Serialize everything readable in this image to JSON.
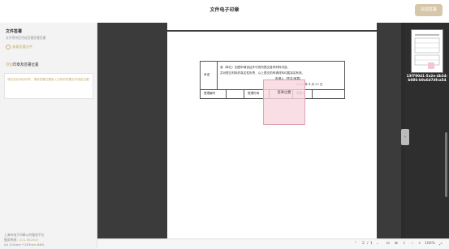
{
  "header": {
    "title": "文件电子印章",
    "confirm_label": "完成签署"
  },
  "sidebar": {
    "file_section_title": "文件签署",
    "file_section_desc": "文件等待您完成签署签署签署",
    "view_file_link": "查看签署文件",
    "mark_section_prefix": "添加",
    "mark_section_title": "印章及签署位置",
    "mark_box_hint": "请在此处添加印章，请将签署位置拖入右侧的签署文件指定位置",
    "footer_org": "上海市电子印章公共服务平台",
    "footer_hotline_label": "服务热线：",
    "footer_hotline": "021-962000",
    "footer_meta": "A4 210mm * 297mm 88%"
  },
  "document": {
    "row_label": "承诺",
    "promise_line1": "我（单位）如镜申请该证许可的所提交各项材料内容，",
    "promise_line2": "并对提交材料的真实性负责，以上提交的申请材料均属真实有效。",
    "applicant_line": "申请人（签名/盖章）",
    "date_line": "2025 年 4 月 22 日",
    "col1": "受理编号",
    "col2": "受理时间",
    "col3": "受理人",
    "seal_label": "签章位置"
  },
  "thumbnail": {
    "name": "13f790d1-5a2e-4b34-b086-b9a6d7dfca54"
  },
  "statusbar": {
    "page_current": "2",
    "page_total": "1",
    "zoom": "100%"
  }
}
